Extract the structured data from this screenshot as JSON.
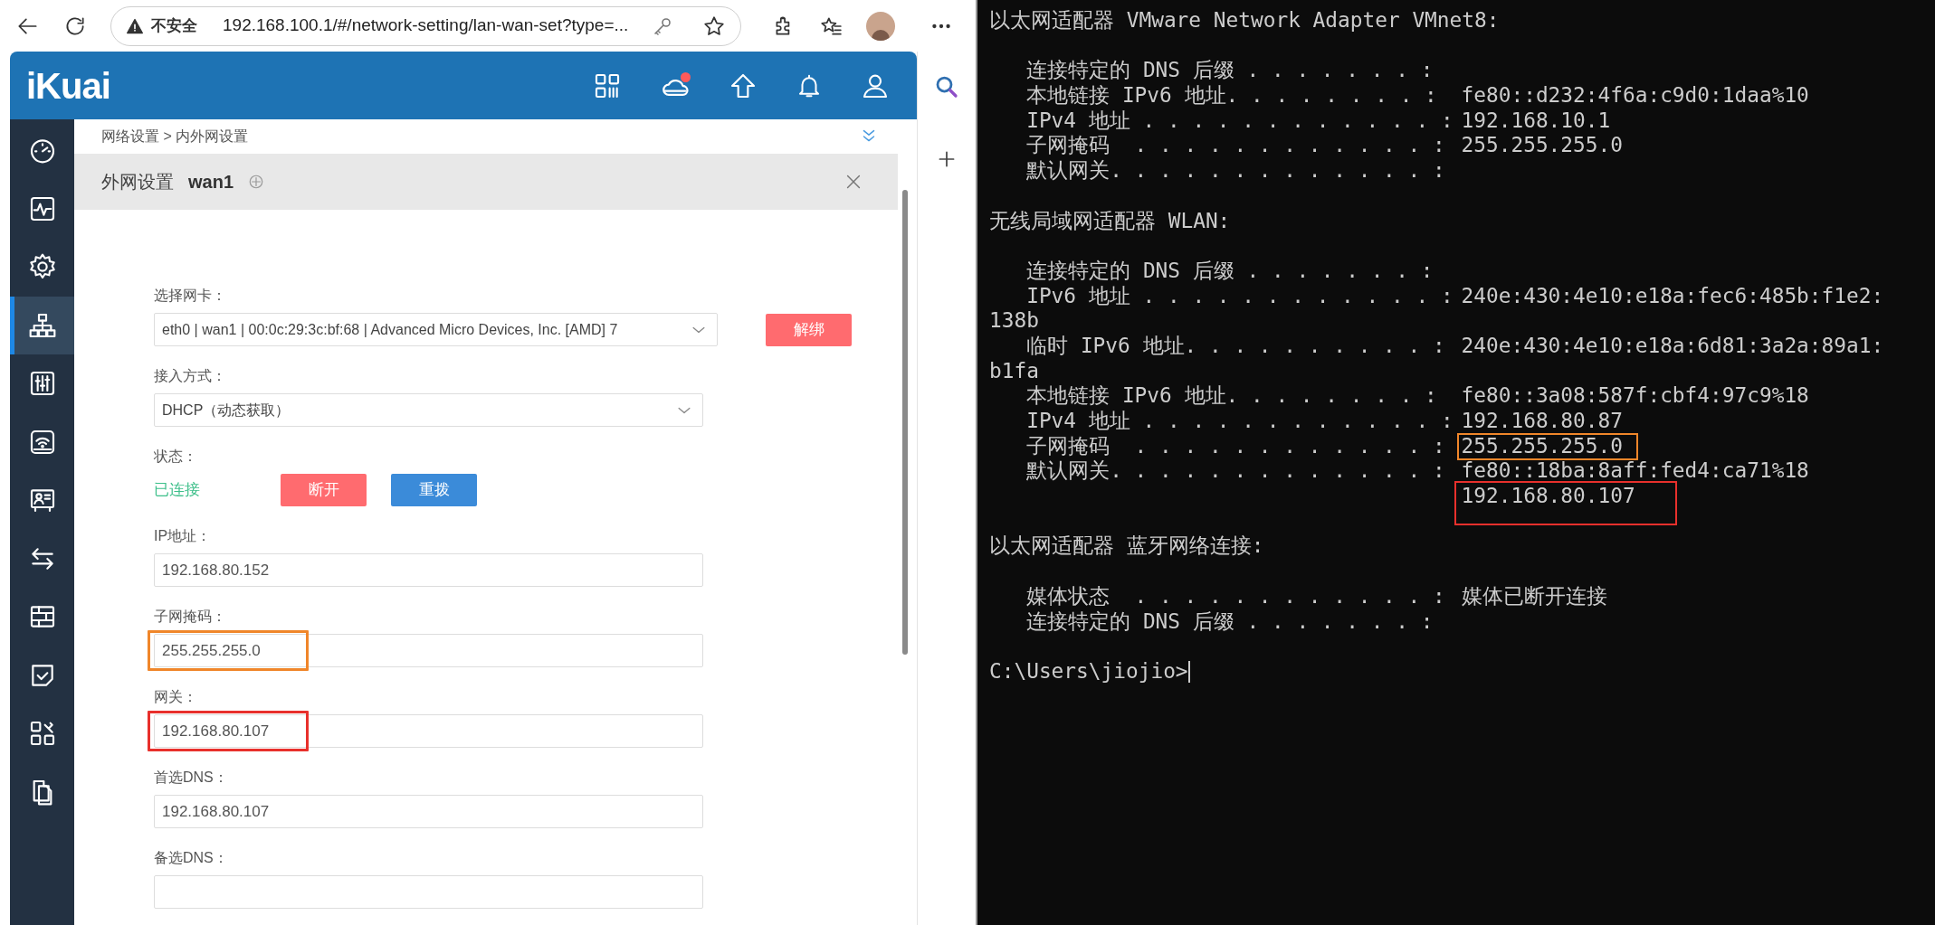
{
  "browser": {
    "security_label": "不安全",
    "url": "192.168.100.1/#/network-setting/lan-wan-set?type=..."
  },
  "app": {
    "logo": "iKuai",
    "cloud_alert": true
  },
  "sidebar": [
    {
      "kind": "gauge",
      "selected": false
    },
    {
      "kind": "pulse",
      "selected": false
    },
    {
      "kind": "gear",
      "selected": false
    },
    {
      "kind": "network",
      "selected": true
    },
    {
      "kind": "sliders",
      "selected": false
    },
    {
      "kind": "wifi",
      "selected": false
    },
    {
      "kind": "card",
      "selected": false
    },
    {
      "kind": "arrows",
      "selected": false
    },
    {
      "kind": "wall",
      "selected": false
    },
    {
      "kind": "check",
      "selected": false
    },
    {
      "kind": "apps",
      "selected": false
    },
    {
      "kind": "files",
      "selected": false
    }
  ],
  "breadcrumb": "网络设置 > 内外网设置",
  "panel": {
    "title": "外网设置",
    "name": "wan1"
  },
  "form": [
    {
      "kind": "select",
      "label": "选择网卡：",
      "value": "eth0 | wan1 | 00:0c:29:3c:bf:68 | Advanced Micro Devices, Inc. [AMD] 7",
      "buttons": [
        {
          "label": "解绑",
          "kind": "danger"
        }
      ]
    },
    {
      "kind": "select",
      "label": "接入方式：",
      "value": "DHCP（动态获取）"
    },
    {
      "kind": "status",
      "label": "状态：",
      "value": "已连接",
      "connected": true,
      "buttons": [
        {
          "label": "断开",
          "kind": "danger"
        },
        {
          "label": "重拨",
          "kind": "primary"
        }
      ]
    },
    {
      "kind": "input",
      "label": "IP地址：",
      "value": "192.168.80.152"
    },
    {
      "kind": "input",
      "label": "子网掩码：",
      "value": "255.255.255.0",
      "color": "#f0862a"
    },
    {
      "kind": "input",
      "label": "网关：",
      "value": "192.168.80.107",
      "color": "#e8302c"
    },
    {
      "kind": "input",
      "label": "首选DNS：",
      "value": "192.168.80.107"
    },
    {
      "kind": "input",
      "label": "备选DNS："
    }
  ],
  "terminal": {
    "lines": [
      {
        "kind": "heading",
        "text": "以太网适配器 VMware Network Adapter VMnet8:"
      },
      {
        "kind": "blank"
      },
      {
        "kind": "entry",
        "label": "连接特定的 DNS 后缀 . . . . . . . :"
      },
      {
        "kind": "entry",
        "label": "本地链接 IPv6 地址. . . . . . . . :",
        "value": "fe80::d232:4f6a:c9d0:1daa%10"
      },
      {
        "kind": "entry",
        "label": "IPv4 地址 . . . . . . . . . . . . :",
        "value": "192.168.10.1"
      },
      {
        "kind": "entry",
        "label": "子网掩码  . . . . . . . . . . . . :",
        "value": "255.255.255.0"
      },
      {
        "kind": "entry",
        "label": "默认网关. . . . . . . . . . . . . :"
      },
      {
        "kind": "blank"
      },
      {
        "kind": "heading",
        "text": "无线局域网适配器 WLAN:"
      },
      {
        "kind": "blank"
      },
      {
        "kind": "entry",
        "label": "连接特定的 DNS 后缀 . . . . . . . :"
      },
      {
        "kind": "entry",
        "label": "IPv6 地址 . . . . . . . . . . . . :",
        "value": "240e:430:4e10:e18a:fec6:485b:f1e2:"
      },
      {
        "kind": "heading",
        "text": "138b"
      },
      {
        "kind": "entry",
        "label": "临时 IPv6 地址. . . . . . . . . . :",
        "value": "240e:430:4e10:e18a:6d81:3a2a:89a1:"
      },
      {
        "kind": "heading",
        "text": "b1fa"
      },
      {
        "kind": "entry",
        "label": "本地链接 IPv6 地址. . . . . . . . :",
        "value": "fe80::3a08:587f:cbf4:97c9%18"
      },
      {
        "kind": "entry",
        "label": "IPv4 地址 . . . . . . . . . . . . :",
        "value": "192.168.80.87"
      },
      {
        "kind": "entry",
        "label": "子网掩码  . . . . . . . . . . . . :",
        "value": "255.255.255.0",
        "color": "#f0862a"
      },
      {
        "kind": "entry",
        "label": "默认网关. . . . . . . . . . . . . :",
        "value": "fe80::18ba:8aff:fed4:ca71%18"
      },
      {
        "kind": "continuation",
        "value": "192.168.80.107",
        "color": "#e8302c"
      },
      {
        "kind": "blank"
      },
      {
        "kind": "heading",
        "text": "以太网适配器 蓝牙网络连接:"
      },
      {
        "kind": "blank"
      },
      {
        "kind": "entry",
        "label": "媒体状态  . . . . . . . . . . . . :",
        "value": "媒体已断开连接"
      },
      {
        "kind": "entry",
        "label": "连接特定的 DNS 后缀 . . . . . . . :"
      },
      {
        "kind": "blank"
      },
      {
        "kind": "heading",
        "text": "C:\\Users\\jiojio>"
      }
    ],
    "cursor": true
  }
}
